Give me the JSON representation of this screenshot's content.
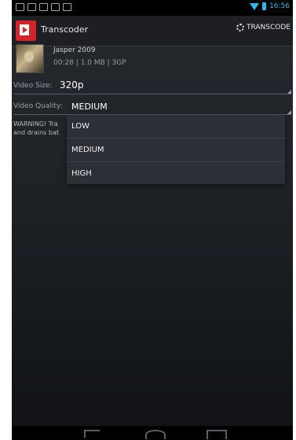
{
  "status_bar": {
    "time": "16:56"
  },
  "action_bar": {
    "title": "Transcoder",
    "transcode_label": "TRANSCODE"
  },
  "video": {
    "title": "Jasper 2009",
    "meta": "00:28 | 1.0 MB | 3GP"
  },
  "video_size": {
    "label": "Video Size:",
    "value": "320p"
  },
  "video_quality": {
    "label": "Video Quality:",
    "value": "MEDIUM"
  },
  "warning": {
    "text": "WARNING! Tra\nand drains bat"
  },
  "dropdown": {
    "options": [
      "LOW",
      "MEDIUM",
      "HIGH"
    ]
  },
  "colors": {
    "accent": "#33b5e5",
    "logo": "#d4232b"
  },
  "icons": [
    "wifi-icon",
    "battery-icon",
    "app-logo-icon",
    "gear-icon",
    "back-icon",
    "home-icon",
    "recent-apps-icon"
  ]
}
